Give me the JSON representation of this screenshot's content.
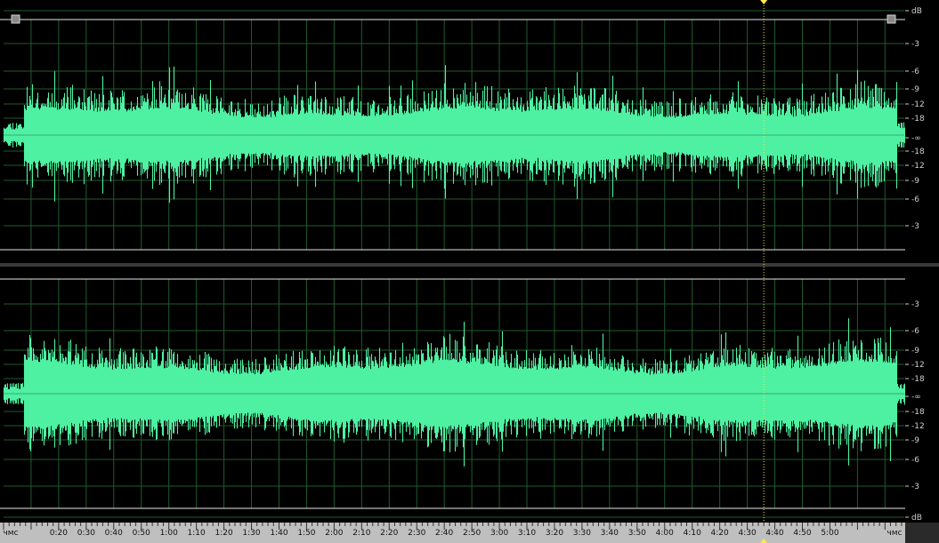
{
  "app": {
    "view": "waveform-editor"
  },
  "colors": {
    "background": "#000000",
    "waveform": "#4ef0a2",
    "grid": "#1f5a2d",
    "centerline": "#3aa874",
    "boundary": "#e6e6e6",
    "cursor": "#ffe94a",
    "ruler_bg": "#bfbfbf",
    "ruler_text": "#111111",
    "scale_text": "#cfcfcf"
  },
  "channels": [
    {
      "name": "channel-1",
      "db_scale": [
        "dB",
        "-3",
        "-6",
        "-9",
        "-12",
        "-18",
        "-∞",
        "-18",
        "-12",
        "-9",
        "-6",
        "-3"
      ],
      "amplitude": {
        "intro": 0.1,
        "body_peak": 0.52,
        "body_floor": 0.26
      }
    },
    {
      "name": "channel-2",
      "db_scale": [
        "-3",
        "-6",
        "-9",
        "-12",
        "-18",
        "-∞",
        "-18",
        "-12",
        "-9",
        "-6",
        "-3",
        "dB"
      ],
      "amplitude": {
        "intro": 0.08,
        "body_peak": 0.55,
        "body_floor": 0.3
      }
    }
  ],
  "timeline": {
    "start_label": "чмс",
    "end_label": "чмс",
    "ticks": [
      "0:20",
      "0:30",
      "0:40",
      "0:50",
      "1:00",
      "1:10",
      "1:20",
      "1:30",
      "1:40",
      "1:50",
      "2:00",
      "2:10",
      "2:20",
      "2:30",
      "2:40",
      "2:50",
      "3:00",
      "3:10",
      "3:20",
      "3:30",
      "3:40",
      "3:50",
      "4:00",
      "4:10",
      "4:20",
      "4:30",
      "4:40",
      "4:50",
      "5:00"
    ],
    "total_seconds": 327,
    "playhead_seconds": 276
  }
}
